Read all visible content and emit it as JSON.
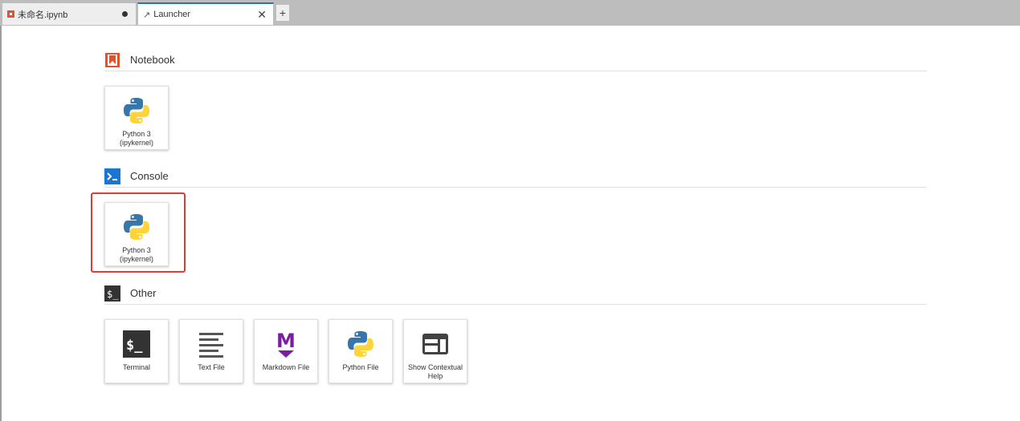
{
  "tabs": [
    {
      "label": "未命名.ipynb",
      "active": false,
      "dirty": true
    },
    {
      "label": "Launcher",
      "active": true,
      "close": "✕"
    }
  ],
  "add_tab_label": "+",
  "sections": {
    "notebook": {
      "title": "Notebook",
      "cards": [
        {
          "line1": "Python 3",
          "line2": "(ipykernel)",
          "icon": "python-logo-icon"
        }
      ]
    },
    "console": {
      "title": "Console",
      "cards": [
        {
          "line1": "Python 3",
          "line2": "(ipykernel)",
          "icon": "python-logo-icon"
        }
      ]
    },
    "other": {
      "title": "Other",
      "cards": [
        {
          "line1": "Terminal",
          "icon": "terminal-icon"
        },
        {
          "line1": "Text File",
          "icon": "text-file-icon"
        },
        {
          "line1": "Markdown File",
          "icon": "markdown-icon"
        },
        {
          "line1": "Python File",
          "icon": "python-logo-icon"
        },
        {
          "line1": "Show Contextual",
          "line2": "Help",
          "icon": "contextual-help-icon"
        }
      ]
    }
  },
  "colors": {
    "notebook_orange": "#e0542b",
    "console_blue": "#1976d2",
    "markdown_purple": "#7b1fa2",
    "python_blue": "#3776ab",
    "python_yellow": "#ffd43b",
    "highlight_red": "#e53935"
  }
}
